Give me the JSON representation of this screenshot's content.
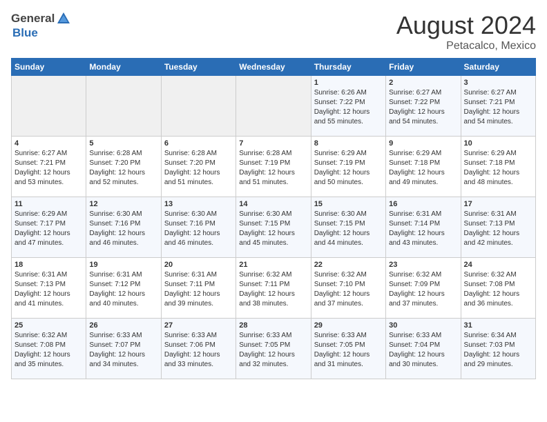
{
  "header": {
    "logo_general": "General",
    "logo_blue": "Blue",
    "month": "August 2024",
    "location": "Petacalco, Mexico"
  },
  "weekdays": [
    "Sunday",
    "Monday",
    "Tuesday",
    "Wednesday",
    "Thursday",
    "Friday",
    "Saturday"
  ],
  "weeks": [
    [
      {
        "day": "",
        "info": ""
      },
      {
        "day": "",
        "info": ""
      },
      {
        "day": "",
        "info": ""
      },
      {
        "day": "",
        "info": ""
      },
      {
        "day": "1",
        "info": "Sunrise: 6:26 AM\nSunset: 7:22 PM\nDaylight: 12 hours\nand 55 minutes."
      },
      {
        "day": "2",
        "info": "Sunrise: 6:27 AM\nSunset: 7:22 PM\nDaylight: 12 hours\nand 54 minutes."
      },
      {
        "day": "3",
        "info": "Sunrise: 6:27 AM\nSunset: 7:21 PM\nDaylight: 12 hours\nand 54 minutes."
      }
    ],
    [
      {
        "day": "4",
        "info": "Sunrise: 6:27 AM\nSunset: 7:21 PM\nDaylight: 12 hours\nand 53 minutes."
      },
      {
        "day": "5",
        "info": "Sunrise: 6:28 AM\nSunset: 7:20 PM\nDaylight: 12 hours\nand 52 minutes."
      },
      {
        "day": "6",
        "info": "Sunrise: 6:28 AM\nSunset: 7:20 PM\nDaylight: 12 hours\nand 51 minutes."
      },
      {
        "day": "7",
        "info": "Sunrise: 6:28 AM\nSunset: 7:19 PM\nDaylight: 12 hours\nand 51 minutes."
      },
      {
        "day": "8",
        "info": "Sunrise: 6:29 AM\nSunset: 7:19 PM\nDaylight: 12 hours\nand 50 minutes."
      },
      {
        "day": "9",
        "info": "Sunrise: 6:29 AM\nSunset: 7:18 PM\nDaylight: 12 hours\nand 49 minutes."
      },
      {
        "day": "10",
        "info": "Sunrise: 6:29 AM\nSunset: 7:18 PM\nDaylight: 12 hours\nand 48 minutes."
      }
    ],
    [
      {
        "day": "11",
        "info": "Sunrise: 6:29 AM\nSunset: 7:17 PM\nDaylight: 12 hours\nand 47 minutes."
      },
      {
        "day": "12",
        "info": "Sunrise: 6:30 AM\nSunset: 7:16 PM\nDaylight: 12 hours\nand 46 minutes."
      },
      {
        "day": "13",
        "info": "Sunrise: 6:30 AM\nSunset: 7:16 PM\nDaylight: 12 hours\nand 46 minutes."
      },
      {
        "day": "14",
        "info": "Sunrise: 6:30 AM\nSunset: 7:15 PM\nDaylight: 12 hours\nand 45 minutes."
      },
      {
        "day": "15",
        "info": "Sunrise: 6:30 AM\nSunset: 7:15 PM\nDaylight: 12 hours\nand 44 minutes."
      },
      {
        "day": "16",
        "info": "Sunrise: 6:31 AM\nSunset: 7:14 PM\nDaylight: 12 hours\nand 43 minutes."
      },
      {
        "day": "17",
        "info": "Sunrise: 6:31 AM\nSunset: 7:13 PM\nDaylight: 12 hours\nand 42 minutes."
      }
    ],
    [
      {
        "day": "18",
        "info": "Sunrise: 6:31 AM\nSunset: 7:13 PM\nDaylight: 12 hours\nand 41 minutes."
      },
      {
        "day": "19",
        "info": "Sunrise: 6:31 AM\nSunset: 7:12 PM\nDaylight: 12 hours\nand 40 minutes."
      },
      {
        "day": "20",
        "info": "Sunrise: 6:31 AM\nSunset: 7:11 PM\nDaylight: 12 hours\nand 39 minutes."
      },
      {
        "day": "21",
        "info": "Sunrise: 6:32 AM\nSunset: 7:11 PM\nDaylight: 12 hours\nand 38 minutes."
      },
      {
        "day": "22",
        "info": "Sunrise: 6:32 AM\nSunset: 7:10 PM\nDaylight: 12 hours\nand 37 minutes."
      },
      {
        "day": "23",
        "info": "Sunrise: 6:32 AM\nSunset: 7:09 PM\nDaylight: 12 hours\nand 37 minutes."
      },
      {
        "day": "24",
        "info": "Sunrise: 6:32 AM\nSunset: 7:08 PM\nDaylight: 12 hours\nand 36 minutes."
      }
    ],
    [
      {
        "day": "25",
        "info": "Sunrise: 6:32 AM\nSunset: 7:08 PM\nDaylight: 12 hours\nand 35 minutes."
      },
      {
        "day": "26",
        "info": "Sunrise: 6:33 AM\nSunset: 7:07 PM\nDaylight: 12 hours\nand 34 minutes."
      },
      {
        "day": "27",
        "info": "Sunrise: 6:33 AM\nSunset: 7:06 PM\nDaylight: 12 hours\nand 33 minutes."
      },
      {
        "day": "28",
        "info": "Sunrise: 6:33 AM\nSunset: 7:05 PM\nDaylight: 12 hours\nand 32 minutes."
      },
      {
        "day": "29",
        "info": "Sunrise: 6:33 AM\nSunset: 7:05 PM\nDaylight: 12 hours\nand 31 minutes."
      },
      {
        "day": "30",
        "info": "Sunrise: 6:33 AM\nSunset: 7:04 PM\nDaylight: 12 hours\nand 30 minutes."
      },
      {
        "day": "31",
        "info": "Sunrise: 6:34 AM\nSunset: 7:03 PM\nDaylight: 12 hours\nand 29 minutes."
      }
    ]
  ]
}
